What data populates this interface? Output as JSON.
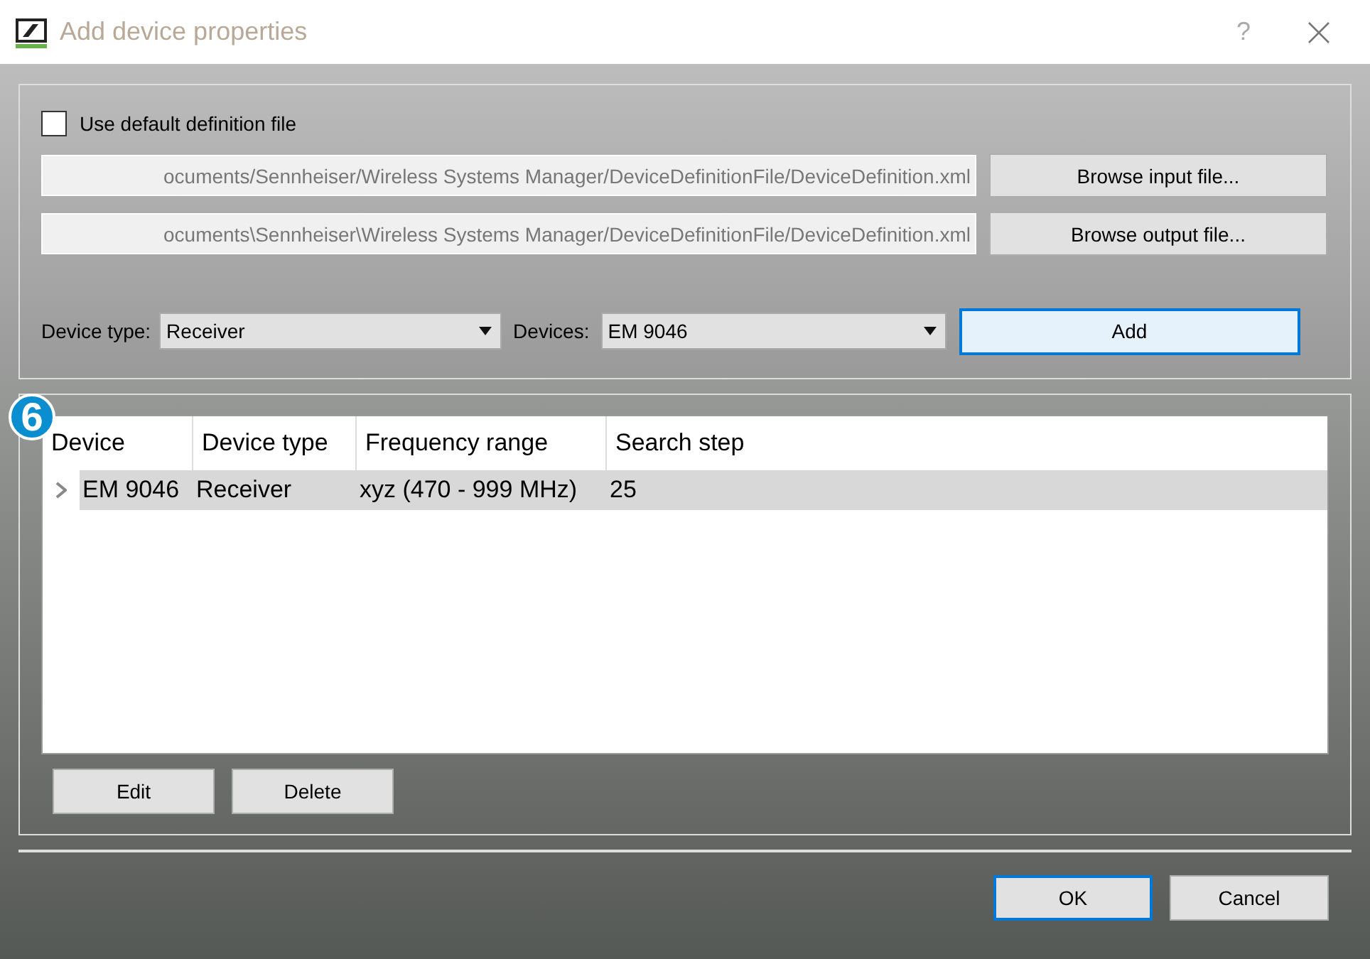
{
  "window": {
    "title": "Add device properties",
    "help": "?"
  },
  "definition": {
    "use_default": {
      "label": "Use default definition file",
      "checked": false
    },
    "input_path": "ocuments/Sennheiser/Wireless Systems Manager/DeviceDefinitionFile/DeviceDefinition.xml",
    "output_path": "ocuments\\Sennheiser\\Wireless Systems Manager/DeviceDefinitionFile/DeviceDefinition.xml",
    "browse_input": {
      "label": "Browse input file...",
      "focused": false
    },
    "browse_output": {
      "label": "Browse output file...",
      "focused": false
    },
    "device_type": {
      "label": "Device type:",
      "value": "Receiver"
    },
    "devices": {
      "label": "Devices:",
      "value": "EM 9046"
    },
    "add": {
      "label": "Add",
      "focused": true
    }
  },
  "callout": "6",
  "table": {
    "columns": [
      "Device",
      "Device type",
      "Frequency range",
      "Search step"
    ],
    "rows": [
      {
        "cells": [
          "EM 9046",
          "Receiver",
          "xyz (470 - 999 MHz)",
          "25"
        ],
        "selected": true,
        "expanded": false
      }
    ]
  },
  "table_buttons": [
    {
      "label": "Edit",
      "focused": false
    },
    {
      "label": "Delete",
      "focused": false
    }
  ],
  "dialog_buttons": [
    {
      "label": "OK",
      "focused": true
    },
    {
      "label": "Cancel",
      "focused": false
    }
  ]
}
